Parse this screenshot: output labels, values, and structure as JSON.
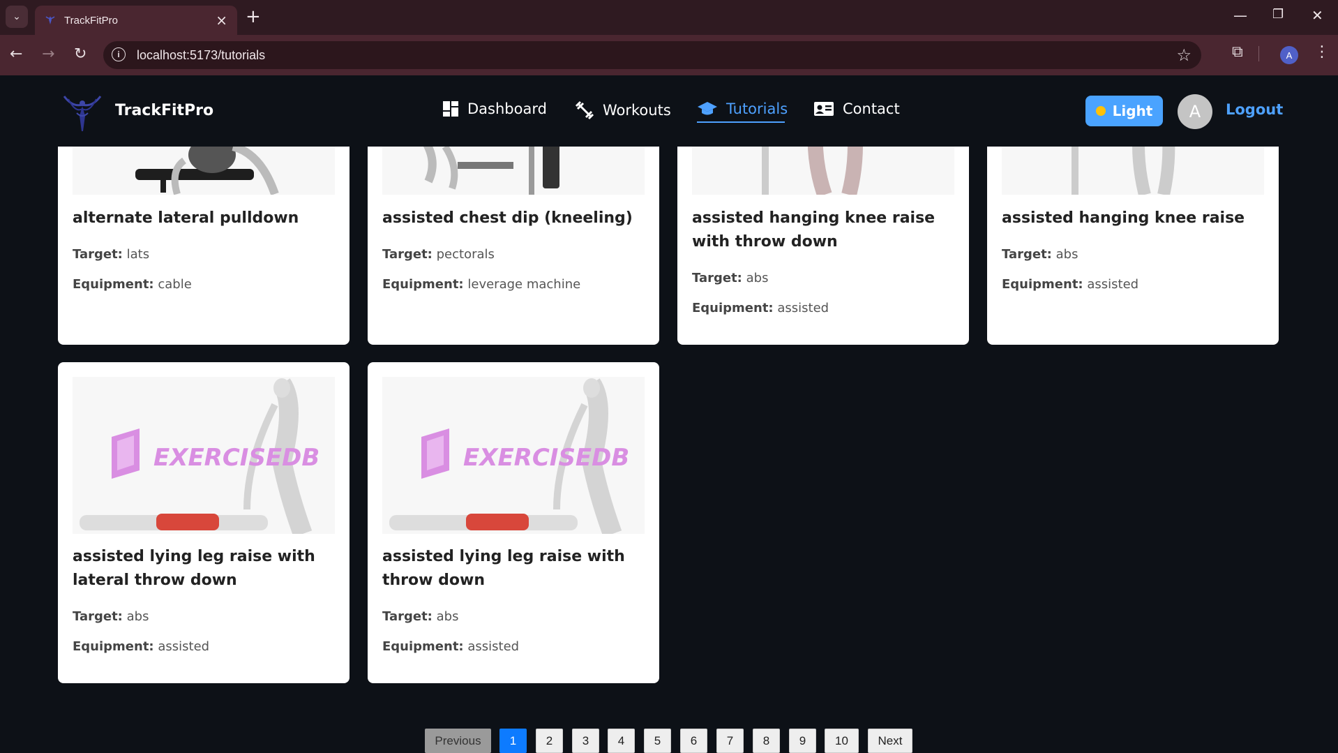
{
  "browser": {
    "tab_title": "TrackFitPro",
    "url": "localhost:5173/tutorials",
    "profile_initial": "A"
  },
  "header": {
    "brand": "TrackFitPro",
    "nav": [
      {
        "label": "Dashboard",
        "icon": "dashboard-icon"
      },
      {
        "label": "Workouts",
        "icon": "dumbbell-icon"
      },
      {
        "label": "Tutorials",
        "icon": "graduation-cap-icon",
        "active": true
      },
      {
        "label": "Contact",
        "icon": "contact-card-icon"
      }
    ],
    "theme_toggle": "Light",
    "avatar_initial": "A",
    "logout": "Logout",
    "accent_color": "#4ea1ff"
  },
  "labels": {
    "target": "Target:",
    "equipment": "Equipment:"
  },
  "cards": [
    {
      "title": "alternate lateral pulldown",
      "target": "lats",
      "equipment": "cable"
    },
    {
      "title": "assisted chest dip (kneeling)",
      "target": "pectorals",
      "equipment": "leverage machine"
    },
    {
      "title": "assisted hanging knee raise with throw down",
      "target": "abs",
      "equipment": "assisted"
    },
    {
      "title": "assisted hanging knee raise",
      "target": "abs",
      "equipment": "assisted"
    },
    {
      "title": "assisted lying leg raise with lateral throw down",
      "target": "abs",
      "equipment": "assisted",
      "watermark": "EXERCISEDB"
    },
    {
      "title": "assisted lying leg raise with throw down",
      "target": "abs",
      "equipment": "assisted",
      "watermark": "EXERCISEDB"
    }
  ],
  "pagination": {
    "previous": "Previous",
    "pages": [
      "1",
      "2",
      "3",
      "4",
      "5",
      "6",
      "7",
      "8",
      "9",
      "10"
    ],
    "current": "1",
    "next": "Next"
  }
}
